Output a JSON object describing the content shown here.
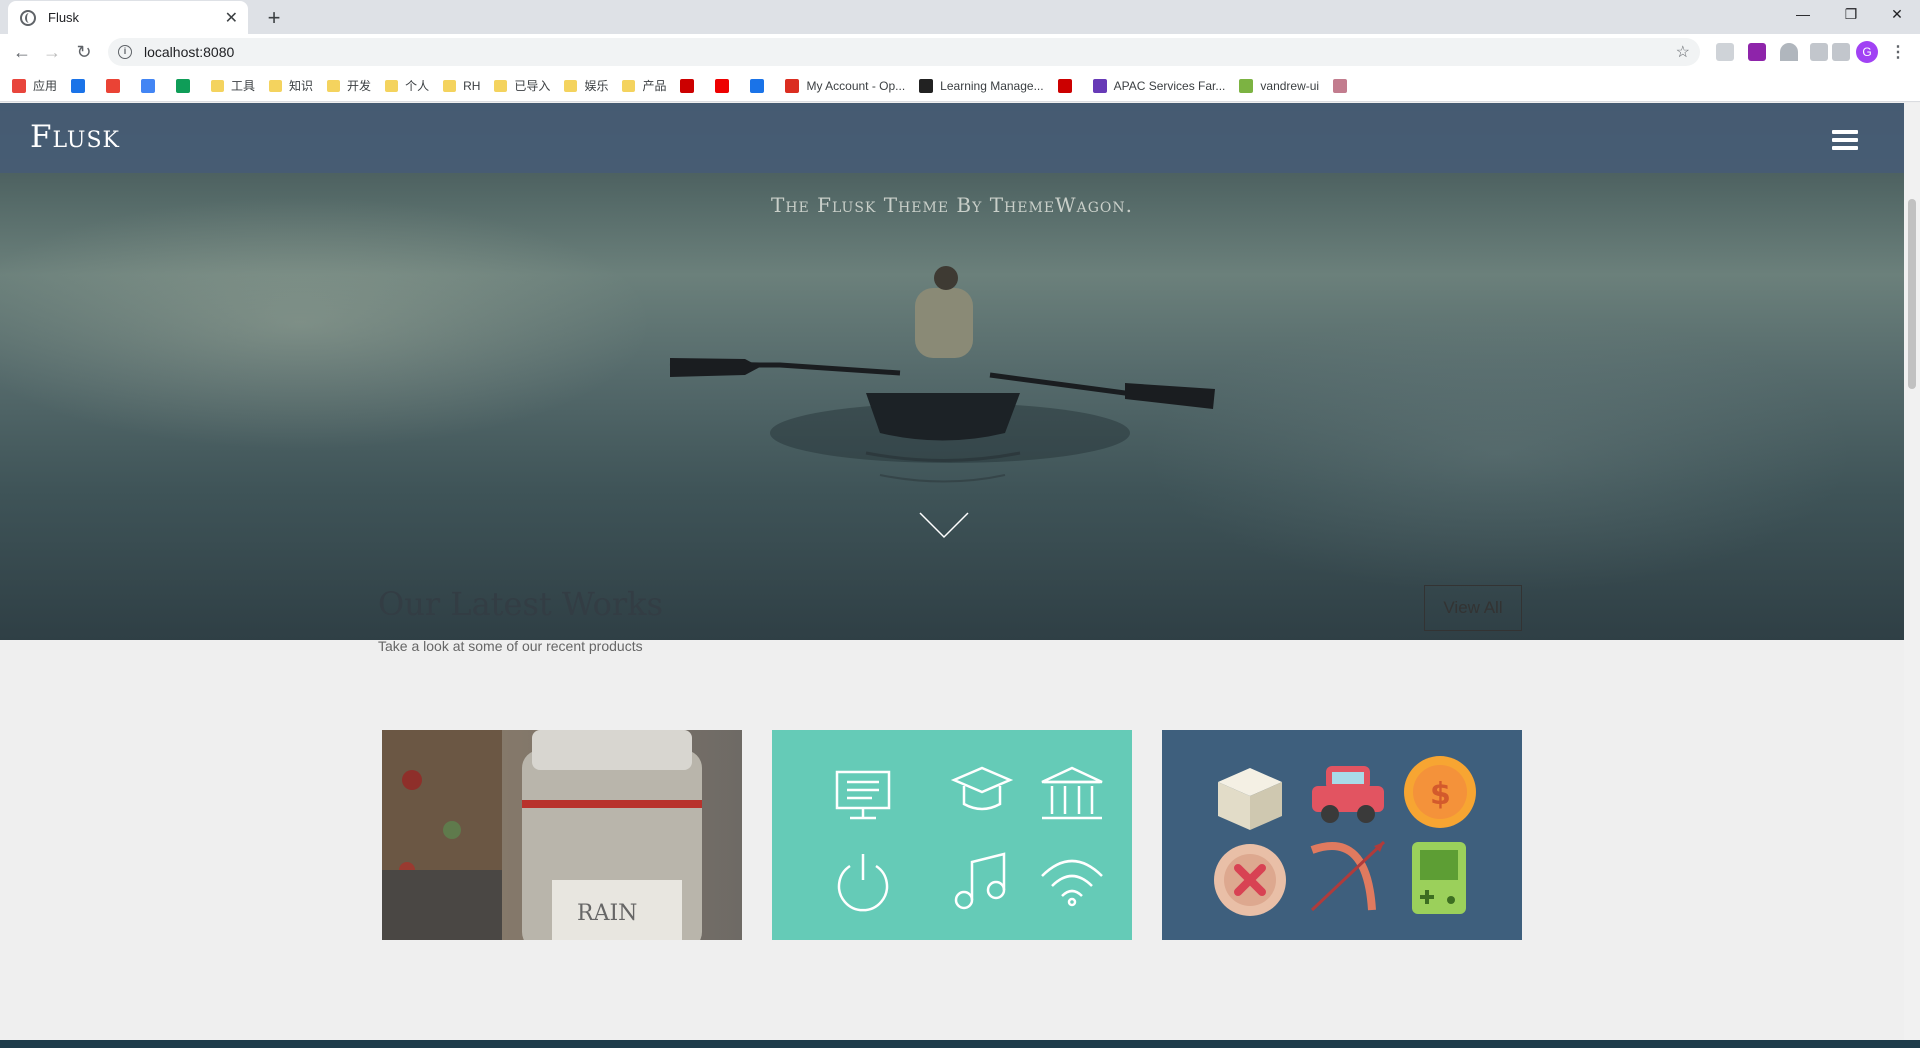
{
  "browser": {
    "tab_title": "Flusk",
    "url": "localhost:8080",
    "avatar_letter": "G"
  },
  "bookmarks": [
    {
      "label": "应用",
      "icon": "apps-grid-icon"
    },
    {
      "label": "",
      "icon": "calendar-icon"
    },
    {
      "label": "",
      "icon": "gmail-icon"
    },
    {
      "label": "",
      "icon": "google-icon"
    },
    {
      "label": "",
      "icon": "drive-icon"
    },
    {
      "label": "工具",
      "icon": "folder-icon"
    },
    {
      "label": "知识",
      "icon": "folder-icon"
    },
    {
      "label": "开发",
      "icon": "folder-icon"
    },
    {
      "label": "个人",
      "icon": "folder-icon"
    },
    {
      "label": "RH",
      "icon": "folder-icon"
    },
    {
      "label": "已导入",
      "icon": "folder-icon"
    },
    {
      "label": "娱乐",
      "icon": "folder-icon"
    },
    {
      "label": "产品",
      "icon": "folder-icon"
    },
    {
      "label": "",
      "icon": "red-c-icon"
    },
    {
      "label": "",
      "icon": "redhat-icon"
    },
    {
      "label": "",
      "icon": "bi-icon"
    },
    {
      "label": "My Account - Op...",
      "icon": "openshift-icon"
    },
    {
      "label": "Learning Manage...",
      "icon": "redhat-learning-icon"
    },
    {
      "label": "",
      "icon": "red-logo-icon"
    },
    {
      "label": "APAC Services Far...",
      "icon": "list-icon"
    },
    {
      "label": "vandrew-ui",
      "icon": "leaf-icon"
    },
    {
      "label": "",
      "icon": "bird-icon"
    }
  ],
  "site": {
    "logo": "Flusk",
    "tagline": "The Flusk Theme By ThemeWagon."
  },
  "works": {
    "title": "Our Latest Works",
    "subtitle": "Take a look at some of our recent products",
    "view_all": "View All",
    "cards": [
      {
        "name": "jar-photo"
      },
      {
        "name": "education-icons"
      },
      {
        "name": "flat-icons"
      }
    ]
  },
  "colors": {
    "nav_bg": "#475c75",
    "card_teal": "#65cbb7",
    "card_navy": "#3e5f7d"
  }
}
